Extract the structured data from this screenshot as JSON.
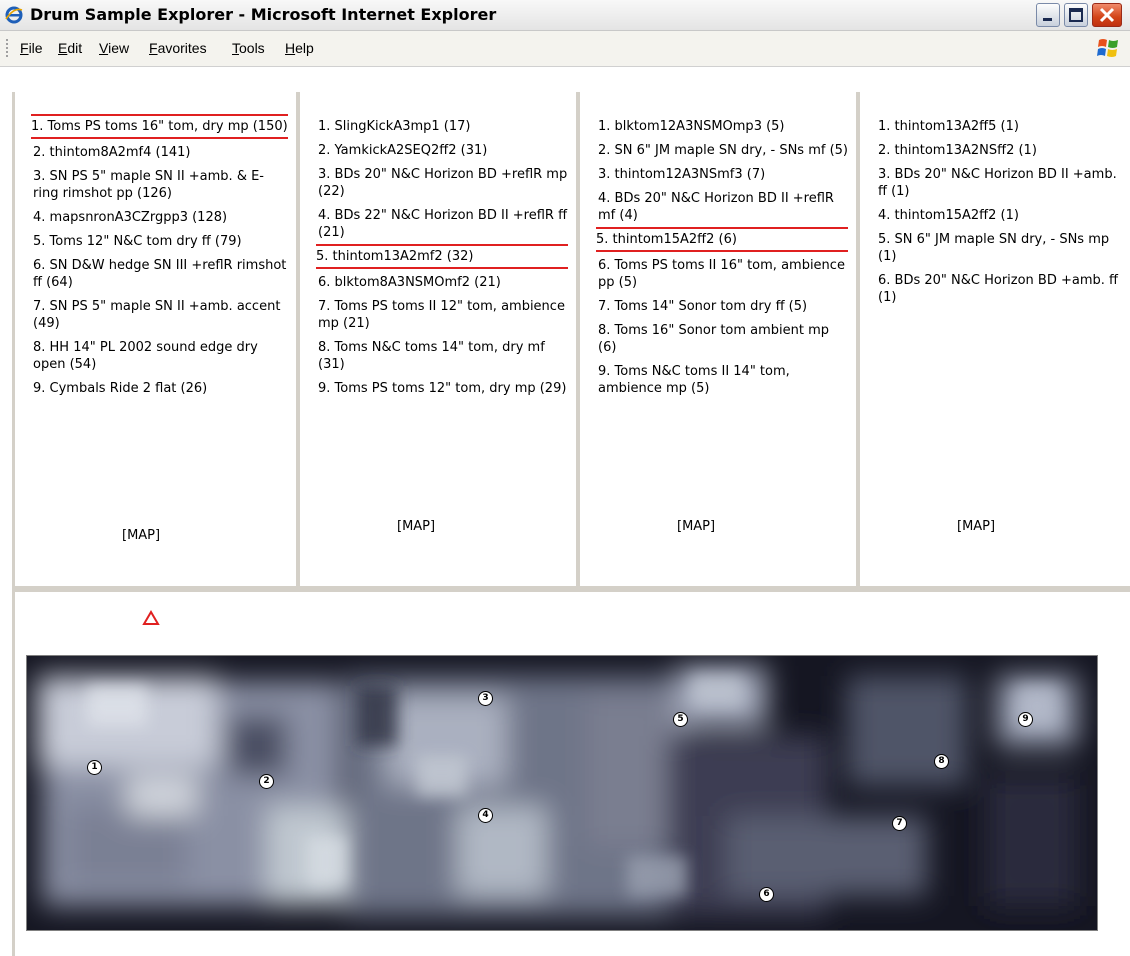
{
  "window": {
    "title": "Drum Sample Explorer - Microsoft Internet Explorer"
  },
  "menu": [
    "File",
    "Edit",
    "View",
    "Favorites",
    "Tools",
    "Help"
  ],
  "panels": [
    {
      "items": [
        "1. Toms PS toms 16\" tom, dry mp (150)",
        "2. thintom8A2mf4 (141)",
        "3. SN PS 5\" maple SN II +amb. & E-ring rimshot pp (126)",
        "4. mapsnronA3CZrgpp3 (128)",
        "5. Toms 12\" N&C tom dry ff (79)",
        "6. SN D&W hedge SN III +reflR rimshot ff (64)",
        "7. SN PS 5\" maple SN II +amb. accent (49)",
        "8. HH 14\" PL 2002 sound edge dry open (54)",
        "9. Cymbals Ride 2 flat (26)"
      ],
      "highlight": 0,
      "map_label": "[MAP]"
    },
    {
      "items": [
        "1. SlingKickA3mp1 (17)",
        "2. YamkickA2SEQ2ff2 (31)",
        "3. BDs 20\" N&C Horizon BD +reflR mp (22)",
        "4. BDs 22\" N&C Horizon BD II +reflR ff (21)",
        "5. thintom13A2mf2 (32)",
        "6. blktom8A3NSMOmf2 (21)",
        "7. Toms PS toms II 12\" tom, ambience mp (21)",
        "8. Toms N&C toms 14\" tom, dry mf (31)",
        "9. Toms PS toms 12\" tom, dry mp (29)"
      ],
      "highlight": 4,
      "map_label": "[MAP]"
    },
    {
      "items": [
        "1. blktom12A3NSMOmp3 (5)",
        "2. SN 6\" JM maple SN dry, - SNs mf (5)",
        "3. thintom12A3NSmf3 (7)",
        "4. BDs 20\" N&C Horizon BD II +reflR mf (4)",
        "5. thintom15A2ff2 (6)",
        "6. Toms PS toms II 16\" tom, ambience pp (5)",
        "7. Toms 14\" Sonor tom dry ff (5)",
        "8. Toms 16\" Sonor tom ambient mp (6)",
        "9. Toms N&C toms II 14\" tom, ambience mp (5)"
      ],
      "highlight": 4,
      "map_label": "[MAP]"
    },
    {
      "items": [
        "1. thintom13A2ff5 (1)",
        "2. thintom13A2NSff2 (1)",
        "3. BDs 20\" N&C Horizon BD II +amb. ff (1)",
        "4. thintom15A2ff2 (1)",
        "5. SN 6\" JM maple SN dry, - SNs mp (1)",
        "6. BDs 20\" N&C Horizon BD +amb. ff (1)"
      ],
      "highlight": -1,
      "map_label": "[MAP]"
    }
  ],
  "map": {
    "markers": [
      "1",
      "2",
      "3",
      "4",
      "5",
      "6",
      "7",
      "8",
      "9"
    ]
  },
  "colors": {
    "highlight": "#e02020",
    "warning": "#e02020"
  }
}
